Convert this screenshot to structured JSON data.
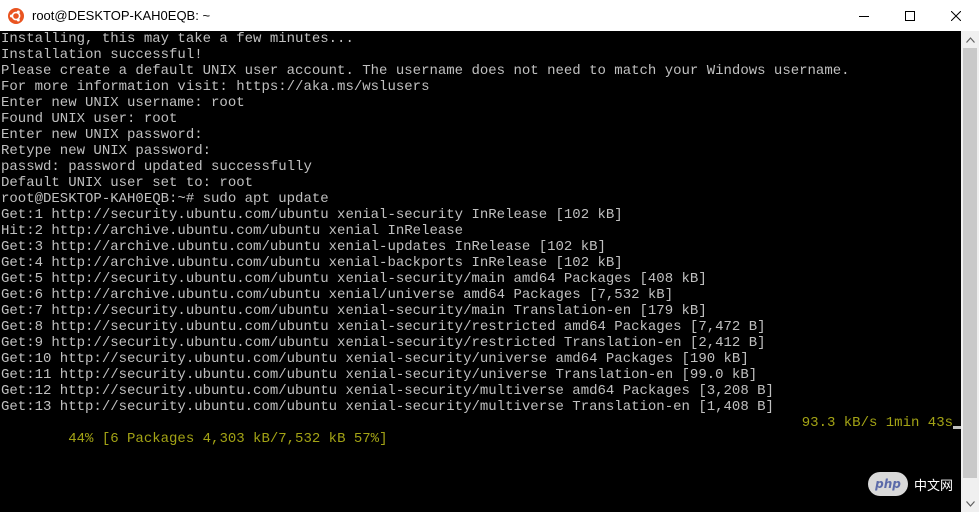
{
  "window": {
    "title": "root@DESKTOP-KAH0EQB: ~"
  },
  "terminal": {
    "lines": [
      "Installing, this may take a few minutes...",
      "Installation successful!",
      "Please create a default UNIX user account. The username does not need to match your Windows username.",
      "For more information visit: https://aka.ms/wslusers",
      "Enter new UNIX username: root",
      "Found UNIX user: root",
      "Enter new UNIX password:",
      "Retype new UNIX password:",
      "passwd: password updated successfully",
      "Default UNIX user set to: root",
      "root@DESKTOP-KAH0EQB:~# sudo apt update",
      "Get:1 http://security.ubuntu.com/ubuntu xenial-security InRelease [102 kB]",
      "Hit:2 http://archive.ubuntu.com/ubuntu xenial InRelease",
      "Get:3 http://archive.ubuntu.com/ubuntu xenial-updates InRelease [102 kB]",
      "Get:4 http://archive.ubuntu.com/ubuntu xenial-backports InRelease [102 kB]",
      "Get:5 http://security.ubuntu.com/ubuntu xenial-security/main amd64 Packages [408 kB]",
      "Get:6 http://archive.ubuntu.com/ubuntu xenial/universe amd64 Packages [7,532 kB]",
      "Get:7 http://security.ubuntu.com/ubuntu xenial-security/main Translation-en [179 kB]",
      "Get:8 http://security.ubuntu.com/ubuntu xenial-security/restricted amd64 Packages [7,472 B]",
      "Get:9 http://security.ubuntu.com/ubuntu xenial-security/restricted Translation-en [2,412 B]",
      "Get:10 http://security.ubuntu.com/ubuntu xenial-security/universe amd64 Packages [190 kB]",
      "Get:11 http://security.ubuntu.com/ubuntu xenial-security/universe Translation-en [99.0 kB]",
      "Get:12 http://security.ubuntu.com/ubuntu xenial-security/multiverse amd64 Packages [3,208 B]",
      "Get:13 http://security.ubuntu.com/ubuntu xenial-security/multiverse Translation-en [1,408 B]"
    ],
    "progress_left": "44% [6 Packages 4,303 kB/7,532 kB 57%]",
    "progress_right": "93.3 kB/s 1min 43s",
    "colors": {
      "background": "#000000",
      "text": "#c0c0c0",
      "progress": "#a3a315"
    }
  },
  "watermark": {
    "logo": "php",
    "text": "中文网"
  },
  "icons": {
    "app": "ubuntu-logo-icon",
    "minimize": "minimize-icon",
    "maximize": "maximize-icon",
    "close": "close-icon"
  }
}
